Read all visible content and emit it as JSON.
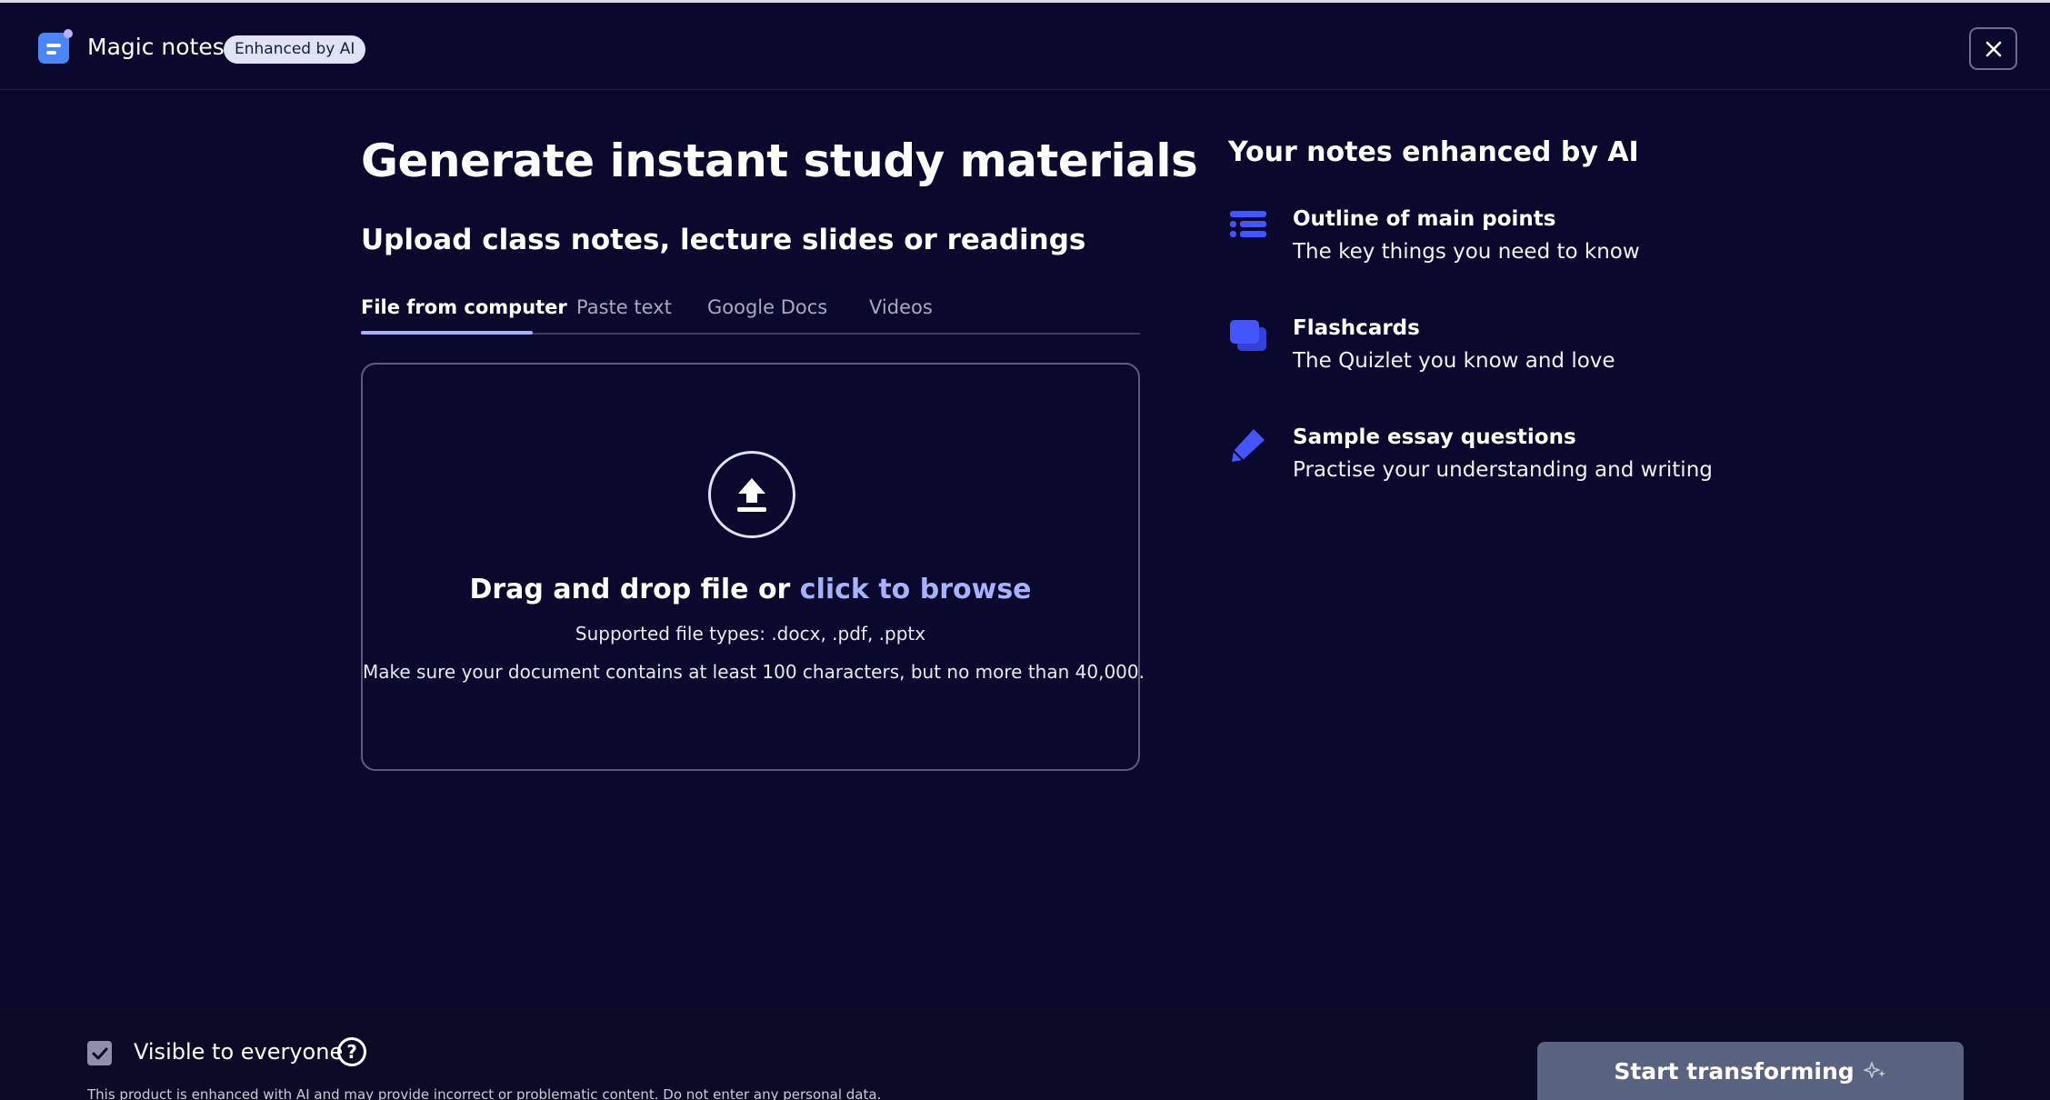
{
  "header": {
    "app_title": "Magic notes",
    "badge": "Enhanced by AI"
  },
  "main": {
    "title": "Generate instant study materials",
    "subtitle": "Upload class notes, lecture slides or readings",
    "tabs": [
      {
        "label": "File from computer",
        "active": true
      },
      {
        "label": "Paste text",
        "active": false
      },
      {
        "label": "Google Docs",
        "active": false
      },
      {
        "label": "Videos",
        "active": false
      }
    ],
    "dropzone": {
      "drag_text": "Drag and drop file or ",
      "browse_link": "click to browse",
      "file_types": "Supported file types: .docx, .pdf, .pptx",
      "limits": "Make sure your document contains at least 100 characters, but no more than 40,000."
    }
  },
  "features": {
    "title": "Your notes enhanced by AI",
    "items": [
      {
        "icon": "list-icon",
        "title": "Outline of main points",
        "description": "The key things you need to know"
      },
      {
        "icon": "flashcards-icon",
        "title": "Flashcards",
        "description": "The Quizlet you know and love"
      },
      {
        "icon": "pencil-icon",
        "title": "Sample essay questions",
        "description": "Practise your understanding and writing"
      }
    ]
  },
  "footer": {
    "visibility_label": "Visible to everyone",
    "visibility_checked": true,
    "disclaimer": "This product is enhanced with AI and may provide incorrect or problematic content. Do not enter any personal data.",
    "start_button": "Start transforming"
  },
  "colors": {
    "background": "#0a092d",
    "accent": "#a8b1ff",
    "feature_icon": "#4255ff",
    "button": "#586380"
  }
}
